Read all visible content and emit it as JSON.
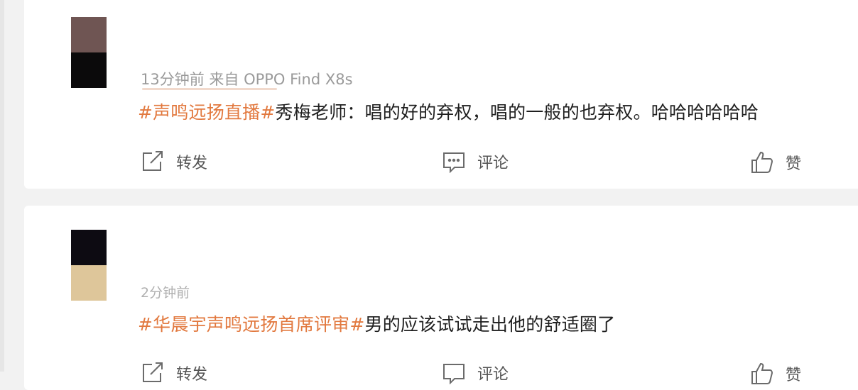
{
  "posts": [
    {
      "avatar_colors": [
        "#6f5553",
        "#0b0a0b"
      ],
      "meta": "13分钟前 来自 OPPO Find X8s",
      "topic": "#声鸣远扬直播#",
      "body": "秀梅老师：唱的好的弃权，唱的一般的也弃权。哈哈哈哈哈哈",
      "actions": {
        "repost": "转发",
        "comment": "评论",
        "like": "赞"
      }
    },
    {
      "avatar_colors": [
        "#0d0b12",
        "#dec69a"
      ],
      "meta": "2分钟前",
      "topic": "#华晨宇声鸣远扬首席评审#",
      "body": "男的应该试试走出他的舒适圈了",
      "actions": {
        "repost": "转发",
        "comment": "评论",
        "like": "赞"
      }
    }
  ],
  "colors": {
    "topic": "#e2793f",
    "text": "#1f1f1f",
    "meta": "#9a9a9a",
    "action": "#555555"
  }
}
